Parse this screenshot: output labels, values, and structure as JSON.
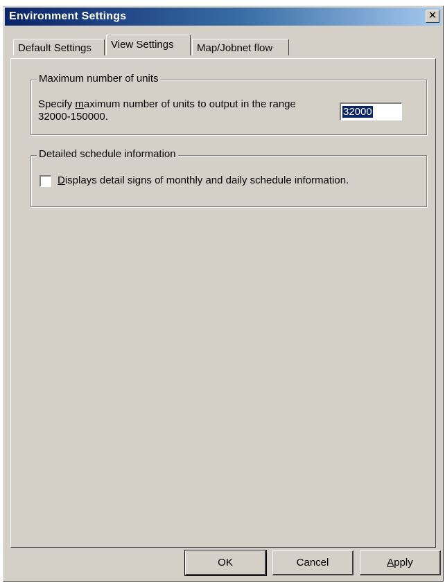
{
  "window": {
    "title": "Environment Settings",
    "close_label": "✕"
  },
  "tabs": [
    {
      "label": "Default Settings",
      "active": false
    },
    {
      "label": "View Settings",
      "active": true
    },
    {
      "label": "Map/Jobnet flow",
      "active": false
    }
  ],
  "max_units": {
    "legend": "Maximum number of units",
    "desc_pre": "Specify ",
    "desc_mnemonic": "m",
    "desc_post": "aximum number of units to output in the range",
    "desc_line2": "32000-150000.",
    "value": "32000"
  },
  "schedule": {
    "legend": "Detailed schedule information",
    "checkbox_mnemonic": "D",
    "checkbox_label_rest": "isplays detail signs of monthly and daily schedule information.",
    "checked": false
  },
  "buttons": {
    "ok": "OK",
    "cancel": "Cancel",
    "apply_mnemonic": "A",
    "apply_rest": "pply"
  },
  "colors": {
    "title_start": "#0a246a",
    "title_end": "#a6caf0",
    "face": "#d4d0c8",
    "selection": "#0a246a"
  }
}
